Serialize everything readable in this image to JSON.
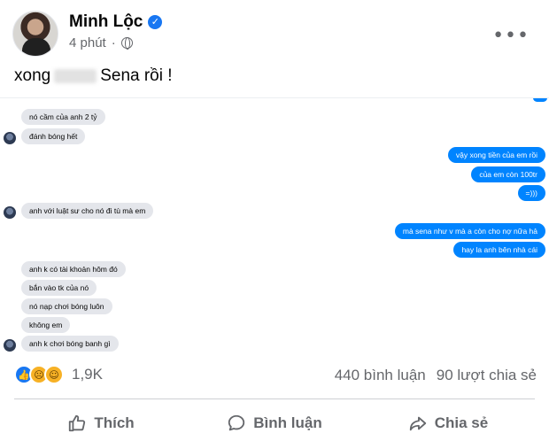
{
  "post": {
    "author": "Minh Lộc",
    "time": "4 phút",
    "caption_before": "xong",
    "caption_after": "Sena rồi !"
  },
  "chat": {
    "in_1": "nó cầm của anh 2 tỷ",
    "in_2": "đánh bóng hết",
    "out_1": "vậy xong tiền của em rồi",
    "out_2": "của em còn 100tr",
    "out_3": "=)))",
    "in_3": "anh với luật sư cho nó đi tù mà em",
    "out_4": "mà sena như v mà a còn cho nợ nữa hả",
    "out_5": "hay la anh bên nhà cái",
    "in_4": "anh k có tài khoản hôm đó",
    "in_5": "bắn vào tk của nó",
    "in_6": "nó nạp chơi bóng luôn",
    "in_7": "không em",
    "in_8": "anh k chơi bóng banh gì"
  },
  "reactions": {
    "count": "1,9K",
    "comments": "440 bình luận",
    "shares": "90 lượt chia sẻ"
  },
  "actions": {
    "like": "Thích",
    "comment": "Bình luận",
    "share": "Chia sẻ"
  },
  "colors": {
    "accent": "#1877f2",
    "outgoing": "#0084ff",
    "incoming": "#e4e6eb",
    "muted": "#65676b"
  }
}
